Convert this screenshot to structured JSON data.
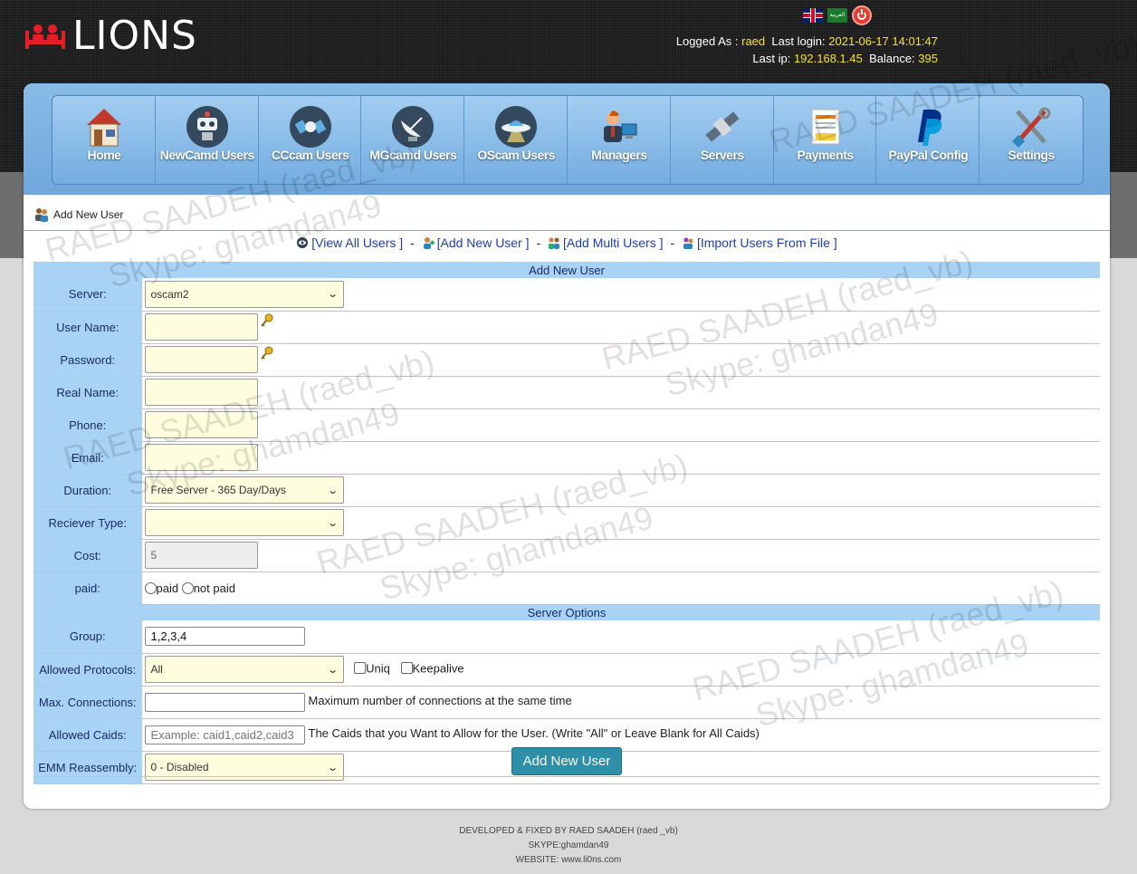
{
  "brand": {
    "name": "LIONS"
  },
  "user": {
    "logged_as_label": "Logged As :",
    "username": "raed",
    "last_login_label": "Last login:",
    "last_login": "2021-06-17 14:01:47",
    "last_ip_label": "Last ip:",
    "last_ip": "192.168.1.45",
    "balance_label": "Balance:",
    "balance": "395"
  },
  "nav": {
    "items": [
      {
        "label": "Home",
        "icon": "house-icon"
      },
      {
        "label": "NewCamd Users",
        "icon": "robot-icon"
      },
      {
        "label": "CCcam Users",
        "icon": "satellite-icon"
      },
      {
        "label": "MGcamd Users",
        "icon": "dish-icon"
      },
      {
        "label": "OScam Users",
        "icon": "ufo-icon"
      },
      {
        "label": "Managers",
        "icon": "manager-icon"
      },
      {
        "label": "Servers",
        "icon": "satellite-server-icon"
      },
      {
        "label": "Payments",
        "icon": "payment-icon"
      },
      {
        "label": "PayPal Config",
        "icon": "paypal-icon"
      },
      {
        "label": "Settings",
        "icon": "tools-icon"
      }
    ]
  },
  "breadcrumb": {
    "label": "Add New User"
  },
  "links": {
    "view_all": "[View All Users ]",
    "add_new": "[Add New User ]",
    "add_multi": "[Add Multi Users ]",
    "import": "[Import Users From File ]",
    "sep": "-"
  },
  "form": {
    "header": "Add New User",
    "server_label": "Server:",
    "server_value": "oscam2",
    "username_label": "User Name:",
    "password_label": "Password:",
    "realname_label": "Real Name:",
    "phone_label": "Phone:",
    "email_label": "Email:",
    "duration_label": "Duration:",
    "duration_value": "Free Server - 365 Day/Days",
    "receiver_label": "Reciever Type:",
    "receiver_value": "",
    "cost_label": "Cost:",
    "cost_value": "5",
    "paid_label": "paid:",
    "paid_option": "paid",
    "not_paid_option": "not paid"
  },
  "options": {
    "header": "Server Options",
    "group_label": "Group:",
    "group_value": "1,2,3,4",
    "protocols_label": "Allowed Protocols:",
    "protocols_value": "All",
    "uniq_label": "Uniq",
    "keepalive_label": "Keepalive",
    "maxconn_label": "Max. Connections:",
    "maxconn_value": "",
    "maxconn_hint": "Maximum number of connections at the same time",
    "caids_label": "Allowed Caids:",
    "caids_placeholder": "Example: caid1,caid2,caid3",
    "caids_hint": "The Caids that you Want to Allow for the User. (Write \"All\" or Leave Blank for All Caids)",
    "emm_label": "EMM Reassembly:",
    "emm_value": "0 - Disabled",
    "submit": "Add New User"
  },
  "watermark": {
    "line1": "RAED SAADEH (raed_vb)",
    "line2": "Skype: ghamdan49"
  },
  "footer": {
    "line1": "DEVELOPED & FIXED BY RAED SAADEH (raed _vb)",
    "line2": "SKYPE:ghamdan49",
    "line3": "WEBSITE: www.li0ns.com"
  },
  "colors": {
    "accent_yellow": "#f5e32b",
    "nav_blue": "#73ade0",
    "label_bg": "#a8d3f5",
    "button": "#2e8fa8",
    "logo_red": "#e31e24"
  }
}
